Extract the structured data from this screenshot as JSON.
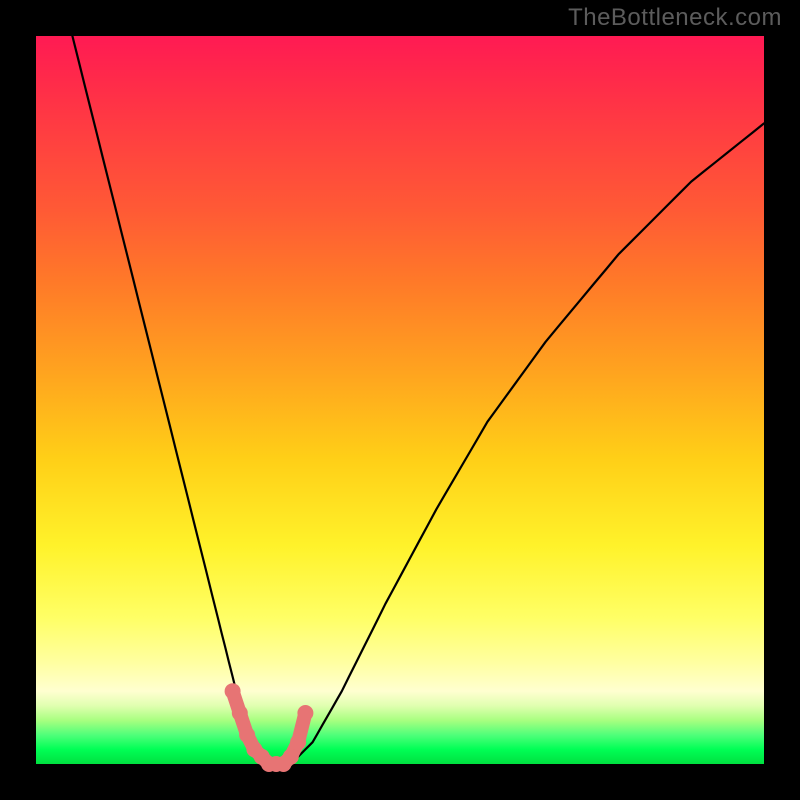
{
  "watermark": "TheBottleneck.com",
  "colors": {
    "frame_bg": "#000000",
    "curve_color": "#000000",
    "highlight_color": "#e77474",
    "watermark_color": "#5c5c5c"
  },
  "chart_data": {
    "type": "line",
    "title": "",
    "xlabel": "",
    "ylabel": "",
    "xlim": [
      0,
      100
    ],
    "ylim": [
      0,
      100
    ],
    "grid": false,
    "series": [
      {
        "name": "bottleneck-curve",
        "x": [
          5,
          10,
          15,
          20,
          25,
          28,
          30,
          32,
          34,
          35,
          38,
          42,
          48,
          55,
          62,
          70,
          80,
          90,
          100
        ],
        "y": [
          100,
          80,
          60,
          40,
          20,
          8,
          3,
          1,
          0,
          0,
          3,
          10,
          22,
          35,
          47,
          58,
          70,
          80,
          88
        ]
      },
      {
        "name": "highlight-region",
        "x": [
          27,
          28,
          29,
          30,
          31,
          32,
          33,
          34,
          35,
          36,
          37
        ],
        "y": [
          10,
          7,
          4,
          2,
          1,
          0,
          0,
          0,
          1,
          3,
          7
        ]
      }
    ]
  }
}
